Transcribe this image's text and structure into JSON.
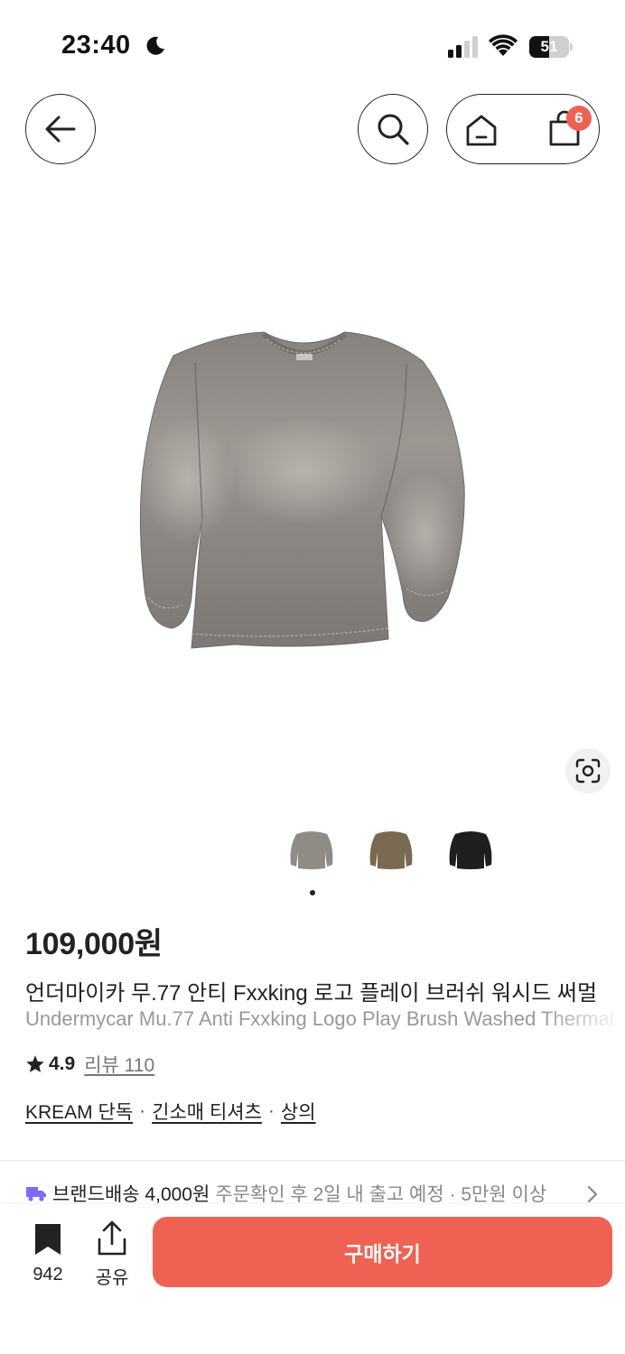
{
  "status": {
    "time": "23:40",
    "battery": "51",
    "battery_level": 0.51
  },
  "nav": {
    "cart_badge": "6"
  },
  "product": {
    "price": "109,000원",
    "title_ko": "언더마이카 무.77 안티 Fxxking 로고 플레이 브러쉬 워시드 써멀",
    "title_en": "Undermycar Mu.77 Anti Fxxking Logo Play Brush Washed Thermal",
    "rating": "4.9",
    "review_text": "리뷰 110",
    "tags": [
      "KREAM 단독",
      "긴소매 티셔츠",
      "상의"
    ],
    "tag_separator": "·",
    "thumbnail_colors": [
      "#8f8b85",
      "#7a6a52",
      "#1e1e1e"
    ]
  },
  "shipping": {
    "label": "브랜드배송 4,000원",
    "detail": "주문확인 후 2일 내 출고 예정 · 5만원 이상"
  },
  "bottom_bar": {
    "bookmark_count": "942",
    "share_label": "공유",
    "buy_label": "구매하기"
  },
  "colors": {
    "accent": "#ef6253",
    "shipping_icon": "#7b6cf6"
  }
}
